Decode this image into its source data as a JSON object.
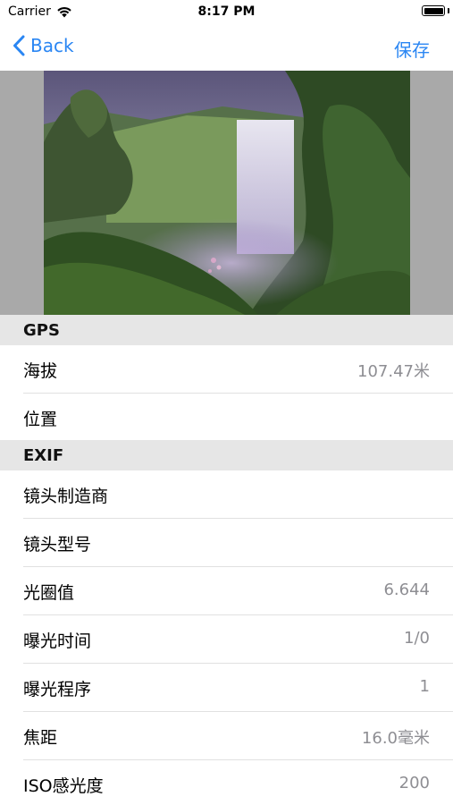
{
  "status_bar": {
    "carrier": "Carrier",
    "time": "8:17 PM",
    "battery_level": 1.0
  },
  "nav": {
    "back_label": "Back",
    "save_label": "保存"
  },
  "photo": {
    "description_icon": "waterfall-photo"
  },
  "sections": {
    "gps": {
      "title": "GPS",
      "rows": [
        {
          "label": "海拔",
          "value": "107.47米"
        },
        {
          "label": "位置",
          "value": ""
        }
      ]
    },
    "exif": {
      "title": "EXIF",
      "rows": [
        {
          "label": "镜头制造商",
          "value": ""
        },
        {
          "label": "镜头型号",
          "value": ""
        },
        {
          "label": "光圈值",
          "value": "6.644"
        },
        {
          "label": "曝光时间",
          "value": "1/0"
        },
        {
          "label": "曝光程序",
          "value": "1"
        },
        {
          "label": "焦距",
          "value": "16.0毫米"
        },
        {
          "label": "ISO感光度",
          "value": "200"
        }
      ]
    }
  },
  "colors": {
    "accent": "#2a86f3",
    "section_bg": "#e6e6e6",
    "secondary_text": "#8e8e93"
  }
}
